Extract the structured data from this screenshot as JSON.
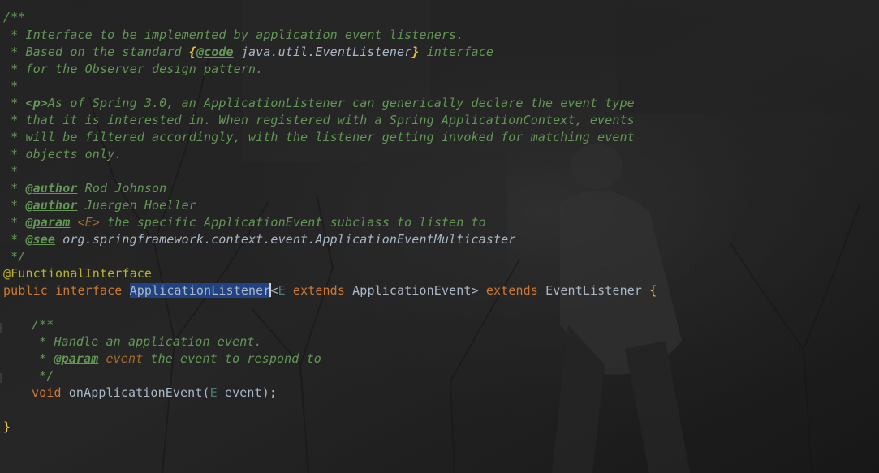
{
  "editor": {
    "javadoc": {
      "open": "/**",
      "l1": " * Interface to be implemented by application event listeners.",
      "l2_a": " * Based on the standard ",
      "l2_brace_open": "{",
      "l2_tag": "@code",
      "l2_code": " java.util.EventListener",
      "l2_brace_close": "}",
      "l2_b": " interface",
      "l3": " * for the Observer design pattern.",
      "l4": " *",
      "l5_a": " * ",
      "l5_p": "<p>",
      "l5_b": "As of Spring 3.0, an ApplicationListener can generically declare the event type",
      "l6": " * that it is interested in. When registered with a Spring ApplicationContext, events",
      "l7": " * will be filtered accordingly, with the listener getting invoked for matching event",
      "l8": " * objects only.",
      "l9": " *",
      "author_prefix": " * ",
      "author_tag": "@author",
      "author1": " Rod Johnson",
      "author2": " Juergen Hoeller",
      "param_tag": "@param",
      "param_name": " <E>",
      "param_desc": " the specific ApplicationEvent subclass to listen to",
      "see_tag": "@see",
      "see_ref": " org.springframework.context.event.ApplicationEventMulticaster",
      "close": " */"
    },
    "annotation": "@FunctionalInterface",
    "decl": {
      "public": "public",
      "interface": "interface",
      "name": "ApplicationListener",
      "lt": "<",
      "E": "E",
      "extends1": "extends",
      "bound": "ApplicationEvent>",
      "extends2": "extends",
      "parent": "EventListener",
      "open": "{"
    },
    "method_doc": {
      "open": "/**",
      "l1": " * Handle an application event.",
      "param_prefix": " * ",
      "param_tag": "@param",
      "param_name": " event",
      "param_desc": " the event to respond to",
      "close": " */"
    },
    "method": {
      "void": "void",
      "name": "onApplicationEvent(",
      "type": "E",
      "arg": " event);"
    },
    "close_brace": "}"
  },
  "colors": {
    "comment": "#629755",
    "keyword": "#cc7832",
    "annotation": "#bbb529",
    "identifier": "#a9b7c6",
    "selection": "#214283",
    "type_param": "#507874"
  }
}
